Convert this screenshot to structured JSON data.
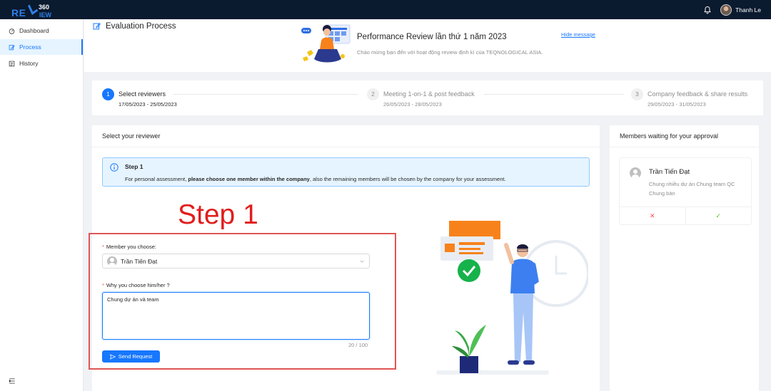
{
  "brand": {
    "logo_main": "RE",
    "logo_suffix": "IEW",
    "logo_num": "360"
  },
  "user": {
    "name": "Thanh Le"
  },
  "sidebar": {
    "items": [
      {
        "label": "Dashboard",
        "icon": "dashboard-icon"
      },
      {
        "label": "Process",
        "icon": "edit-icon",
        "active": true
      },
      {
        "label": "History",
        "icon": "history-icon"
      }
    ]
  },
  "header": {
    "title": "Evaluation Process",
    "banner_title": "Performance Review lần thứ 1 năm 2023",
    "banner_subtitle": "Chào mừng bạn đến với hoạt động review định kì của TEQNOLOGICAL ASIA.",
    "hide_message": "Hide message"
  },
  "steps": [
    {
      "num": "1",
      "label": "Select reviewers",
      "dates": "17/05/2023 - 25/05/2023"
    },
    {
      "num": "2",
      "label": "Meeting 1-on-1 & post feedback",
      "dates": "26/05/2023 - 28/05/2023"
    },
    {
      "num": "3",
      "label": "Company feedback & share results",
      "dates": "29/05/2023 - 31/05/2023"
    }
  ],
  "main": {
    "card_title": "Select your reviewer",
    "alert_title": "Step 1",
    "alert_text_pre": "For personal assessment, ",
    "alert_text_bold": "please choose one member within the company",
    "alert_text_post": ", also the remaining members will be chosen by the company for your assessment.",
    "overlay_text": "Step 1",
    "member_label": "Member you choose:",
    "member_value": "Trần Tiến Đạt",
    "reason_label": "Why you choose him/her ?",
    "reason_value": "Chung dự án và team",
    "counter": "20 / 100",
    "send_label": "Send Request"
  },
  "side": {
    "card_title": "Members waiting for your approval",
    "member_name": "Trần Tiến Đạt",
    "member_desc": "Chung nhiều dự án Chung team QC Chung bàn",
    "reject_symbol": "✕",
    "accept_symbol": "✓"
  },
  "colors": {
    "primary": "#1677ff",
    "topbar": "#0a1a2f",
    "overlay_red": "#e11d1d"
  }
}
